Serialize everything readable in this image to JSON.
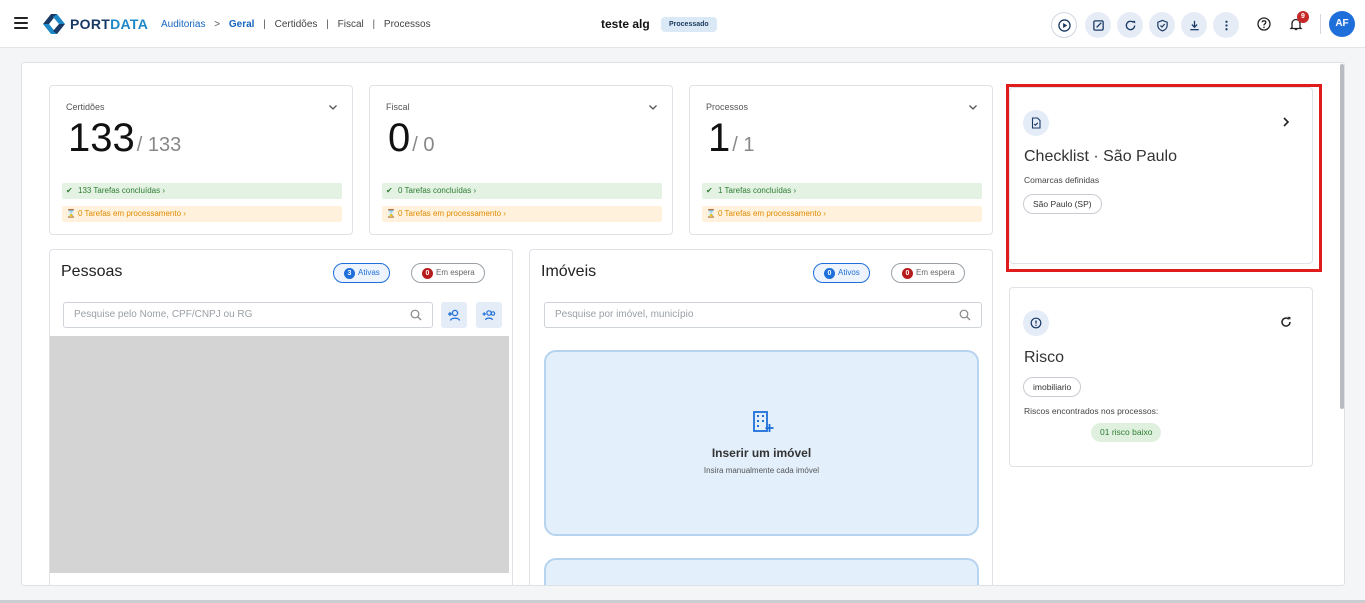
{
  "header": {
    "brand_part1": "PORT",
    "brand_part2": "DATA",
    "breadcrumb": {
      "root": "Auditorias",
      "arrow": ">",
      "active": "Geral",
      "items": [
        "Certidões",
        "Fiscal",
        "Processos"
      ],
      "separator": "|"
    },
    "doc_title": "teste alg",
    "doc_status": "Processado",
    "notification_count": "9",
    "avatar_initials": "AF"
  },
  "stats": [
    {
      "label": "Certidões",
      "value": "133",
      "total": "/ 133",
      "done": "133 Tarefas concluídas",
      "processing": "0 Tarefas em processamento"
    },
    {
      "label": "Fiscal",
      "value": "0",
      "total": "/ 0",
      "done": "0 Tarefas concluídas",
      "processing": "0 Tarefas em processamento"
    },
    {
      "label": "Processos",
      "value": "1",
      "total": "/ 1",
      "done": "1 Tarefas concluídas",
      "processing": "0 Tarefas em processamento"
    }
  ],
  "pessoas": {
    "title": "Pessoas",
    "active_count": "3",
    "active_label": "Ativas",
    "waiting_count": "0",
    "waiting_label": "Em espera",
    "search_placeholder": "Pesquise pelo Nome, CPF/CNPJ ou RG"
  },
  "imoveis": {
    "title": "Imóveis",
    "active_count": "0",
    "active_label": "Ativos",
    "waiting_count": "0",
    "waiting_label": "Em espera",
    "search_placeholder": "Pesquise por imóvel, município",
    "insert_title": "Inserir um imóvel",
    "insert_subtitle": "Insira manualmente cada imóvel"
  },
  "checklist": {
    "title": "Checklist · São Paulo",
    "subtitle": "Comarcas definidas",
    "chip": "São Paulo (SP)"
  },
  "risco": {
    "title": "Risco",
    "chip": "imobiliario",
    "subtitle": "Riscos encontrados nos processos:",
    "result": "01 risco baixo"
  },
  "colors": {
    "brand_dark": "#1a3a66",
    "brand_light": "#1e88c7",
    "accent": "#1e6fd9",
    "highlight": "#e01b1b"
  }
}
